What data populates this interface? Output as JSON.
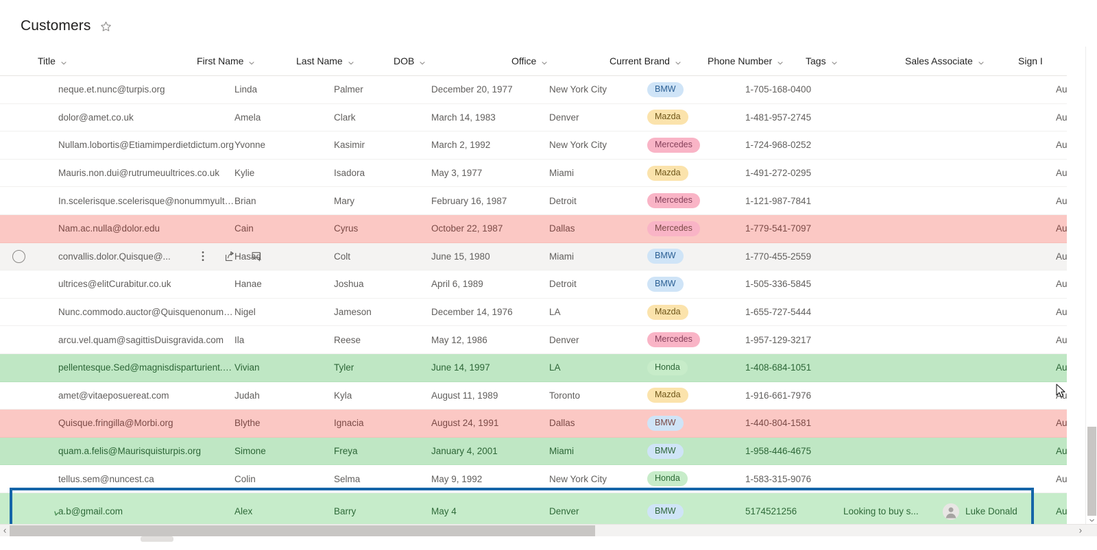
{
  "header": {
    "title": "Customers",
    "favorite_icon": "star-icon"
  },
  "table": {
    "columns": [
      {
        "key": "title",
        "label": "Title"
      },
      {
        "key": "first_name",
        "label": "First Name"
      },
      {
        "key": "last_name",
        "label": "Last Name"
      },
      {
        "key": "dob",
        "label": "DOB"
      },
      {
        "key": "office",
        "label": "Office"
      },
      {
        "key": "current_brand",
        "label": "Current Brand"
      },
      {
        "key": "phone",
        "label": "Phone Number"
      },
      {
        "key": "tags",
        "label": "Tags"
      },
      {
        "key": "sales_associate",
        "label": "Sales Associate"
      },
      {
        "key": "sign",
        "label": "Sign I"
      }
    ],
    "row_actions": {
      "select_label": "Select row",
      "more_icon": "ellipsis-vertical-icon",
      "share_icon": "share-icon",
      "comment_icon": "add-comment-icon"
    },
    "brand_colors": {
      "BMW": "#cfe4f7",
      "Mazda": "#fbe3ac",
      "Mercedes": "#f9b4c6",
      "Honda": "#c7ecc9"
    },
    "row_state_colors": {
      "rose": "#fbc8c4",
      "green": "#bfe7c4",
      "hover": "#f4f3f2",
      "active_outline": "#1565a8",
      "active_row": "#c6ecca"
    },
    "rows": [
      {
        "title": "neque.et.nunc@turpis.org",
        "first_name": "Linda",
        "last_name": "Palmer",
        "dob": "December 20, 1977",
        "office": "New York City",
        "current_brand": "BMW",
        "brand_class": "bmw",
        "phone": "1-705-168-0400",
        "tags": "",
        "sales_associate": "",
        "sign": "Augus",
        "state": ""
      },
      {
        "title": "dolor@amet.co.uk",
        "first_name": "Amela",
        "last_name": "Clark",
        "dob": "March 14, 1983",
        "office": "Denver",
        "current_brand": "Mazda",
        "brand_class": "mazda",
        "phone": "1-481-957-2745",
        "tags": "",
        "sales_associate": "",
        "sign": "Augus",
        "state": ""
      },
      {
        "title": "Nullam.lobortis@Etiamimperdietdictum.org",
        "first_name": "Yvonne",
        "last_name": "Kasimir",
        "dob": "March 2, 1992",
        "office": "New York City",
        "current_brand": "Mercedes",
        "brand_class": "mercedes",
        "phone": "1-724-968-0252",
        "tags": "",
        "sales_associate": "",
        "sign": "Augus",
        "state": ""
      },
      {
        "title": "Mauris.non.dui@rutrumeuultrices.co.uk",
        "first_name": "Kylie",
        "last_name": "Isadora",
        "dob": "May 3, 1977",
        "office": "Miami",
        "current_brand": "Mazda",
        "brand_class": "mazda",
        "phone": "1-491-272-0295",
        "tags": "",
        "sales_associate": "",
        "sign": "Augus",
        "state": ""
      },
      {
        "title": "In.scelerisque.scelerisque@nonummyultrici...",
        "first_name": "Brian",
        "last_name": "Mary",
        "dob": "February 16, 1987",
        "office": "Detroit",
        "current_brand": "Mercedes",
        "brand_class": "mercedes",
        "phone": "1-121-987-7841",
        "tags": "",
        "sales_associate": "",
        "sign": "Augus",
        "state": ""
      },
      {
        "title": "Nam.ac.nulla@dolor.edu",
        "first_name": "Cain",
        "last_name": "Cyrus",
        "dob": "October 22, 1987",
        "office": "Dallas",
        "current_brand": "Mercedes",
        "brand_class": "mercedes",
        "phone": "1-779-541-7097",
        "tags": "",
        "sales_associate": "",
        "sign": "Augus",
        "state": "rose"
      },
      {
        "title": "convallis.dolor.Quisque@...",
        "first_name": "Hasad",
        "last_name": "Colt",
        "dob": "June 15, 1980",
        "office": "Miami",
        "current_brand": "BMW",
        "brand_class": "bmw",
        "phone": "1-770-455-2559",
        "tags": "",
        "sales_associate": "",
        "sign": "Augus",
        "state": "hover"
      },
      {
        "title": "ultrices@elitCurabitur.co.uk",
        "first_name": "Hanae",
        "last_name": "Joshua",
        "dob": "April 6, 1989",
        "office": "Detroit",
        "current_brand": "BMW",
        "brand_class": "bmw",
        "phone": "1-505-336-5845",
        "tags": "",
        "sales_associate": "",
        "sign": "Augus",
        "state": ""
      },
      {
        "title": "Nunc.commodo.auctor@Quisquenonummy...",
        "first_name": "Nigel",
        "last_name": "Jameson",
        "dob": "December 14, 1976",
        "office": "LA",
        "current_brand": "Mazda",
        "brand_class": "mazda",
        "phone": "1-655-727-5444",
        "tags": "",
        "sales_associate": "",
        "sign": "Augus",
        "state": ""
      },
      {
        "title": "arcu.vel.quam@sagittisDuisgravida.com",
        "first_name": "Ila",
        "last_name": "Reese",
        "dob": "May 12, 1986",
        "office": "Denver",
        "current_brand": "Mercedes",
        "brand_class": "mercedes",
        "phone": "1-957-129-3217",
        "tags": "",
        "sales_associate": "",
        "sign": "Augus",
        "state": ""
      },
      {
        "title": "pellentesque.Sed@magnisdisparturient.org",
        "first_name": "Vivian",
        "last_name": "Tyler",
        "dob": "June 14, 1997",
        "office": "LA",
        "current_brand": "Honda",
        "brand_class": "honda",
        "phone": "1-408-684-1051",
        "tags": "",
        "sales_associate": "",
        "sign": "Augus",
        "state": "green"
      },
      {
        "title": "amet@vitaeposuereat.com",
        "first_name": "Judah",
        "last_name": "Kyla",
        "dob": "August 11, 1989",
        "office": "Toronto",
        "current_brand": "Mazda",
        "brand_class": "mazda",
        "phone": "1-916-661-7976",
        "tags": "",
        "sales_associate": "",
        "sign": "Augu",
        "state": ""
      },
      {
        "title": "Quisque.fringilla@Morbi.org",
        "first_name": "Blythe",
        "last_name": "Ignacia",
        "dob": "August 24, 1991",
        "office": "Dallas",
        "current_brand": "BMW",
        "brand_class": "bmw",
        "phone": "1-440-804-1581",
        "tags": "",
        "sales_associate": "",
        "sign": "Augus",
        "state": "rose"
      },
      {
        "title": "quam.a.felis@Maurisquisturpis.org",
        "first_name": "Simone",
        "last_name": "Freya",
        "dob": "January 4, 2001",
        "office": "Miami",
        "current_brand": "BMW",
        "brand_class": "bmw",
        "phone": "1-958-446-4675",
        "tags": "",
        "sales_associate": "",
        "sign": "Augus",
        "state": "green"
      },
      {
        "title": "tellus.sem@nuncest.ca",
        "first_name": "Colin",
        "last_name": "Selma",
        "dob": "May 9, 1992",
        "office": "New York City",
        "current_brand": "Honda",
        "brand_class": "honda",
        "phone": "1-583-315-9076",
        "tags": "",
        "sales_associate": "",
        "sign": "Augus",
        "state": ""
      },
      {
        "title": "a.b@gmail.com",
        "first_name": "Alex",
        "last_name": "Barry",
        "dob": "May 4",
        "office": "Denver",
        "current_brand": "BMW",
        "brand_class": "bmw",
        "phone": "5174521256",
        "tags": "Looking to buy s...",
        "sales_associate": "Luke Donald",
        "sign": "Augus",
        "state": "active"
      }
    ]
  },
  "scrollbars": {
    "horizontal_name": "horizontal-scrollbar",
    "vertical_name": "vertical-scrollbar"
  }
}
